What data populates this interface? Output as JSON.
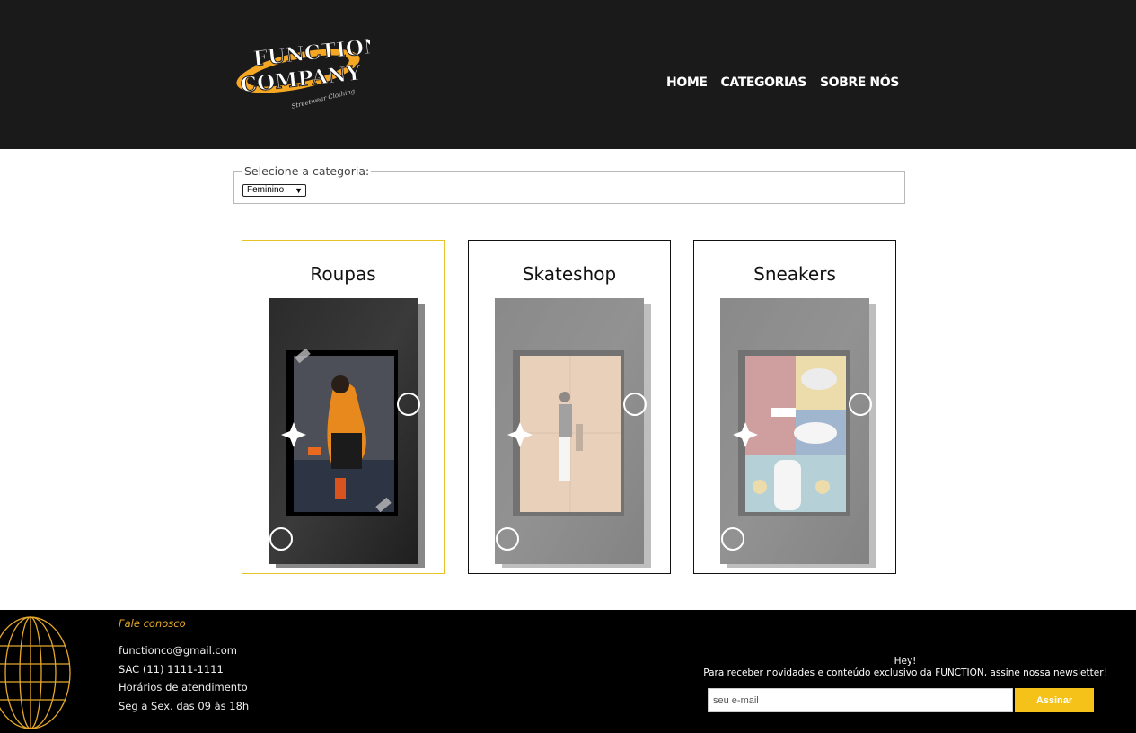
{
  "brand": {
    "logo_line1": "FUNCTION",
    "logo_line2": "COMPANY",
    "logo_tagline": "Streetwear Clothing",
    "accent_color": "#f5a623"
  },
  "nav": {
    "items": [
      {
        "label": "HOME"
      },
      {
        "label": "CATEGORIAS"
      },
      {
        "label": "SOBRE NÓS"
      }
    ]
  },
  "filter": {
    "legend": "Selecione a categoria:",
    "selected": "Feminino"
  },
  "cards": [
    {
      "title": "Roupas",
      "image": "orange-jacket-photo"
    },
    {
      "title": "Skateshop",
      "image": "skateboarder-photo"
    },
    {
      "title": "Sneakers",
      "image": "sneakers-flatlay-photo"
    }
  ],
  "footer": {
    "contact_title": "Fale conosco",
    "email": "functionco@gmail.com",
    "phone": "SAC (11) 1111-1111",
    "hours_title": "Horários de atendimento",
    "hours": "Seg a Sex. das 09 às 18h",
    "newsletter_hey": "Hey!",
    "newsletter_text": "Para receber novidades e conteúdo exclusivo da FUNCTION, assine nossa newsletter!",
    "email_placeholder": "seu e-mail",
    "subscribe_label": "Assinar"
  }
}
